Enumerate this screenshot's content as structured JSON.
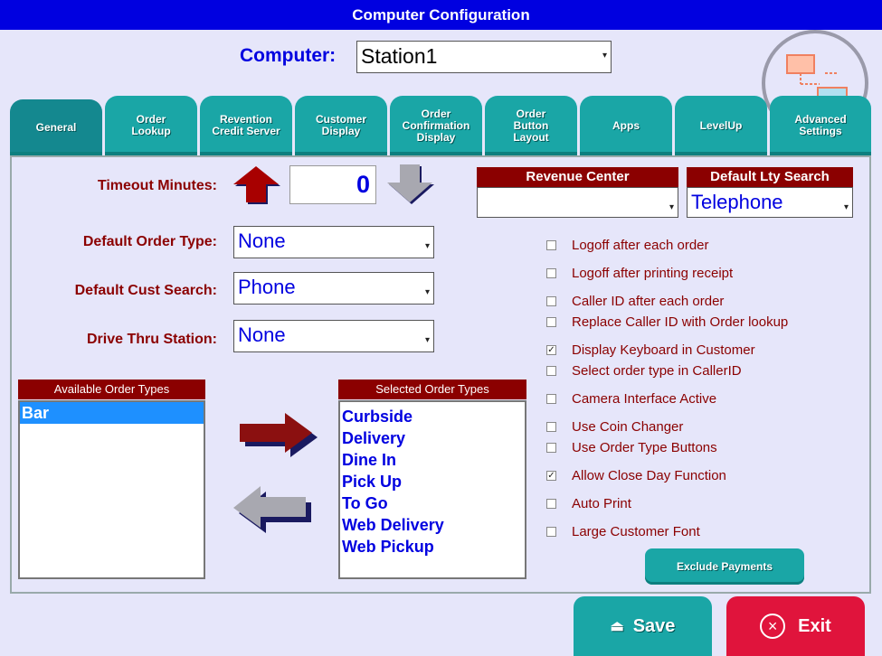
{
  "window": {
    "title": "Computer Configuration"
  },
  "computer": {
    "label": "Computer:",
    "value": "Station1"
  },
  "tabs": [
    {
      "label": "General"
    },
    {
      "label": "Order Lookup"
    },
    {
      "label": "Revention Credit Server"
    },
    {
      "label": "Customer Display"
    },
    {
      "label": "Order Confirmation Display"
    },
    {
      "label": "Order Button Layout"
    },
    {
      "label": "Apps"
    },
    {
      "label": "LevelUp"
    },
    {
      "label": "Advanced Settings"
    }
  ],
  "general": {
    "timeout_label": "Timeout Minutes:",
    "timeout_value": "0",
    "revenue_center": {
      "header": "Revenue Center",
      "value": ""
    },
    "default_lty_search": {
      "header": "Default Lty Search",
      "value": "Telephone"
    },
    "default_order_type": {
      "label": "Default Order Type:",
      "value": "None"
    },
    "default_cust_search": {
      "label": "Default Cust Search:",
      "value": "Phone"
    },
    "drive_thru_station": {
      "label": "Drive Thru Station:",
      "value": "None"
    },
    "available_header": "Available Order Types",
    "available_items": [
      "Bar"
    ],
    "selected_header": "Selected Order Types",
    "selected_items": [
      "Curbside",
      "Delivery",
      "Dine In",
      "Pick Up",
      "To Go",
      "Web Delivery",
      "Web Pickup"
    ],
    "options": [
      {
        "label": "Logoff after each order",
        "checked": false
      },
      {
        "label": "Logoff after printing receipt",
        "checked": false
      },
      {
        "label": "Caller ID after each order",
        "checked": false
      },
      {
        "label": "Replace Caller ID with Order lookup",
        "checked": false
      },
      {
        "label": "Display Keyboard in Customer",
        "checked": true
      },
      {
        "label": "Select order type in CallerID",
        "checked": false
      },
      {
        "label": "Camera Interface Active",
        "checked": false
      },
      {
        "label": "Use Coin Changer",
        "checked": false
      },
      {
        "label": "Use Order Type Buttons",
        "checked": false
      },
      {
        "label": "Allow Close Day Function",
        "checked": true
      },
      {
        "label": "Auto Print",
        "checked": false
      },
      {
        "label": "Large Customer Font",
        "checked": false
      }
    ],
    "exclude_payments_label": "Exclude Payments"
  },
  "footer": {
    "save_label": "Save",
    "exit_label": "Exit"
  },
  "colors": {
    "title": "#0000e0",
    "tab": "#1aa6a6",
    "label": "#8b0000",
    "save": "#1aa6a6",
    "exit": "#e0143c"
  }
}
